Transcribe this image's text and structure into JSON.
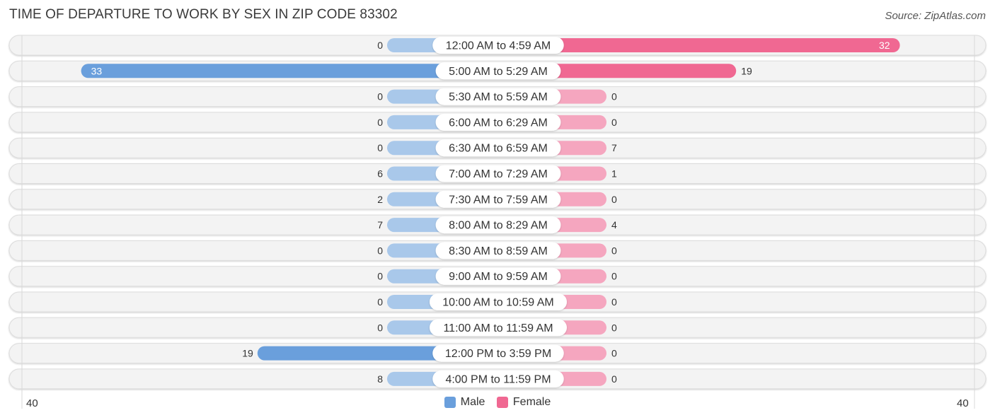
{
  "chart_data": {
    "type": "bar",
    "orientation": "horizontal-diverging",
    "title": "TIME OF DEPARTURE TO WORK BY SEX IN ZIP CODE 83302",
    "source": "Source: ZipAtlas.com",
    "categories": [
      "12:00 AM to 4:59 AM",
      "5:00 AM to 5:29 AM",
      "5:30 AM to 5:59 AM",
      "6:00 AM to 6:29 AM",
      "6:30 AM to 6:59 AM",
      "7:00 AM to 7:29 AM",
      "7:30 AM to 7:59 AM",
      "8:00 AM to 8:29 AM",
      "8:30 AM to 8:59 AM",
      "9:00 AM to 9:59 AM",
      "10:00 AM to 10:59 AM",
      "11:00 AM to 11:59 AM",
      "12:00 PM to 3:59 PM",
      "4:00 PM to 11:59 PM"
    ],
    "series": [
      {
        "name": "Male",
        "color": "#6a9fdc",
        "light_color": "#a9c8ea",
        "values": [
          0,
          33,
          0,
          0,
          0,
          6,
          2,
          7,
          0,
          0,
          0,
          0,
          19,
          8
        ]
      },
      {
        "name": "Female",
        "color": "#f06892",
        "light_color": "#f5a6bf",
        "values": [
          32,
          19,
          0,
          0,
          7,
          1,
          0,
          4,
          0,
          0,
          0,
          0,
          0,
          0
        ]
      }
    ],
    "axis": {
      "min_label": "40",
      "max_label": "40",
      "range": [
        -40,
        40
      ]
    },
    "legend": {
      "position": "bottom-center",
      "items": [
        "Male",
        "Female"
      ]
    },
    "grid": false
  }
}
